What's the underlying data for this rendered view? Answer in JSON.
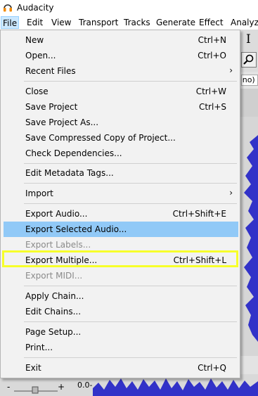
{
  "window": {
    "title": "Audacity"
  },
  "menubar": {
    "items": [
      {
        "label": "File",
        "active": true
      },
      {
        "label": "Edit"
      },
      {
        "label": "View"
      },
      {
        "label": "Transport"
      },
      {
        "label": "Tracks"
      },
      {
        "label": "Generate"
      },
      {
        "label": "Effect"
      },
      {
        "label": "Analyze"
      }
    ]
  },
  "background": {
    "mono_label": "ono)",
    "bottom_value": "0.0-"
  },
  "file_menu": {
    "items": [
      {
        "label": "New",
        "shortcut": "Ctrl+N"
      },
      {
        "label": "Open...",
        "shortcut": "Ctrl+O"
      },
      {
        "label": "Recent Files",
        "submenu_arrow": "›"
      },
      {
        "label": "Close",
        "shortcut": "Ctrl+W"
      },
      {
        "label": "Save Project",
        "shortcut": "Ctrl+S"
      },
      {
        "label": "Save Project As..."
      },
      {
        "label": "Save Compressed Copy of Project..."
      },
      {
        "label": "Check Dependencies..."
      },
      {
        "label": "Edit Metadata Tags..."
      },
      {
        "label": "Import",
        "submenu_arrow": "›"
      },
      {
        "label": "Export Audio...",
        "shortcut": "Ctrl+Shift+E"
      },
      {
        "label": "Export Selected Audio...",
        "state": "highlighted"
      },
      {
        "label": "Export Labels...",
        "state": "disabled"
      },
      {
        "label": "Export Multiple...",
        "shortcut": "Ctrl+Shift+L"
      },
      {
        "label": "Export MIDI...",
        "state": "disabled"
      },
      {
        "label": "Apply Chain..."
      },
      {
        "label": "Edit Chains..."
      },
      {
        "label": "Page Setup..."
      },
      {
        "label": "Print..."
      },
      {
        "label": "Exit",
        "shortcut": "Ctrl+Q"
      }
    ]
  },
  "colors": {
    "highlight": "#91c9f7",
    "annotation_box": "#f7ff2a",
    "menu_bg": "#f2f2f2",
    "waveform": "#3232c8"
  }
}
